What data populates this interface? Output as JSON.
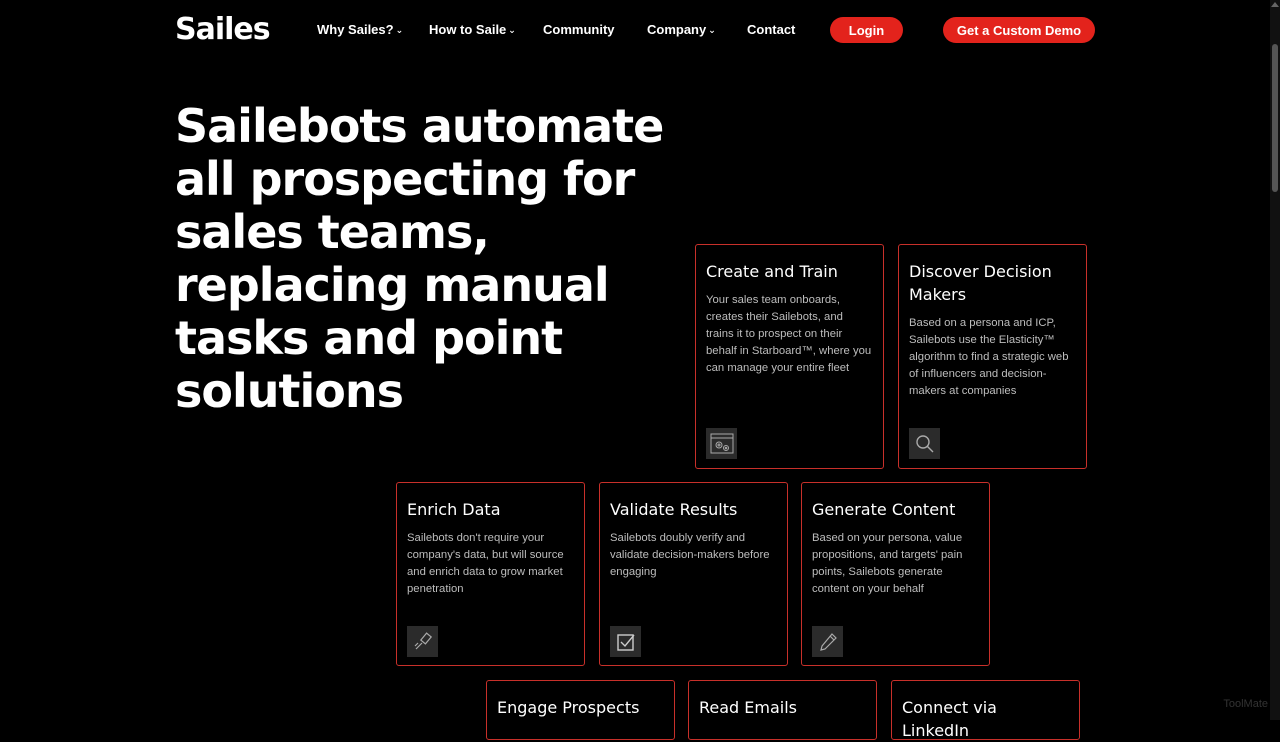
{
  "brand": {
    "logo_text": "Sailes",
    "accent": "#e3231c",
    "card_border": "#c8302a"
  },
  "nav": {
    "items": [
      {
        "label": "Why Sailes?",
        "dropdown": true
      },
      {
        "label": "How to Saile",
        "dropdown": true
      },
      {
        "label": "Community",
        "dropdown": false
      },
      {
        "label": "Company",
        "dropdown": true
      },
      {
        "label": "Contact",
        "dropdown": false
      }
    ],
    "chevron": "⌄",
    "login_label": "Login",
    "demo_label": "Get a Custom Demo"
  },
  "hero": {
    "title": "Sailebots automate all prospecting for sales teams, replacing manual tasks and point solutions"
  },
  "cards": [
    {
      "title": "Create and Train",
      "body": "Your sales team onboards, creates their Sailebots, and trains it to prospect on their behalf in Starboard™, where you can manage your entire fleet",
      "icon": "browser-gear-icon"
    },
    {
      "title": "Discover Decision Makers",
      "body": "Based on a persona and ICP, Sailebots use the Elasticity™ algorithm to find a strategic web of influencers and decision-makers at companies",
      "icon": "magnifier-icon"
    },
    {
      "title": "Enrich Data",
      "body": "Sailebots don't require your company's data, but will source and enrich data to grow market penetration",
      "icon": "brush-icon"
    },
    {
      "title": "Validate Results",
      "body": "Sailebots doubly verify and validate decision-makers before engaging",
      "icon": "checkbox-icon"
    },
    {
      "title": "Generate Content",
      "body": "Based on your persona, value propositions, and targets' pain points, Sailebots generate content on your behalf",
      "icon": "pencil-icon"
    },
    {
      "title": "Engage Prospects",
      "body": "",
      "icon": ""
    },
    {
      "title": "Read Emails",
      "body": "",
      "icon": ""
    },
    {
      "title": "Connect via LinkedIn",
      "body": "",
      "icon": ""
    }
  ],
  "watermark": "ToolMate"
}
